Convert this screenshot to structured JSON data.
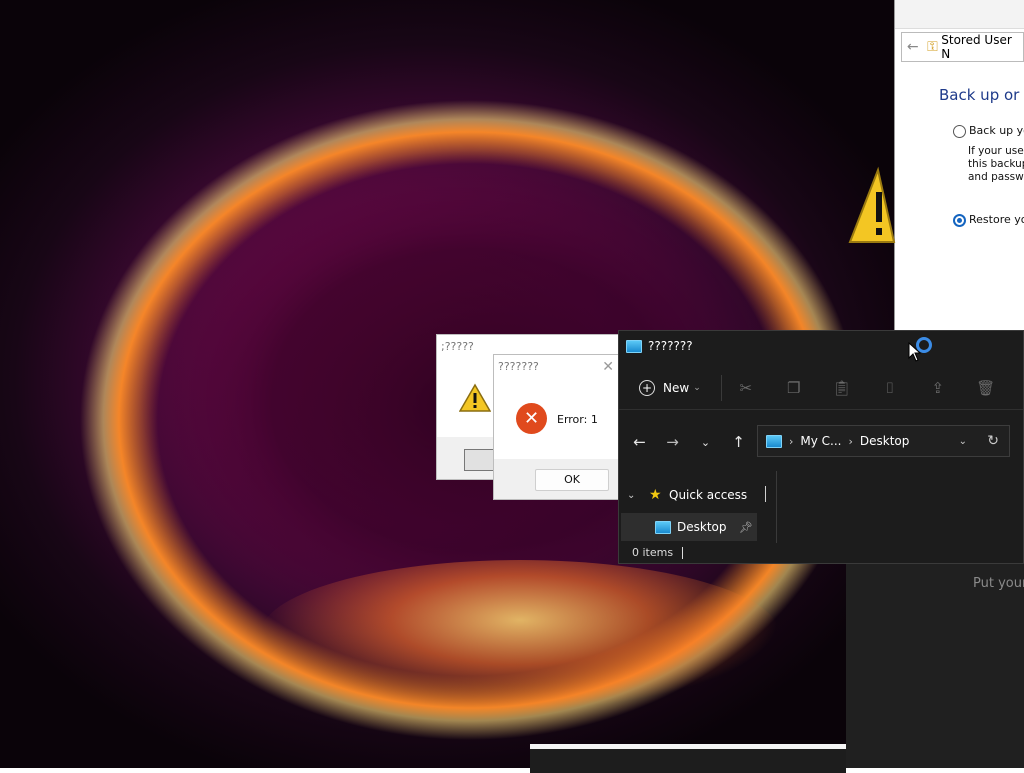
{
  "stored_window": {
    "title": "Stored User N",
    "heading": "Back up or re",
    "option_backup": "Back up you",
    "backup_desc_line1": "If your user n",
    "backup_desc_line2": "this backup",
    "backup_desc_line3": "and passwo",
    "option_restore": "Restore you"
  },
  "dialog_warning": {
    "title": ";?????"
  },
  "dialog_error": {
    "title": "???????",
    "message": "Error: 1",
    "ok_label": "OK"
  },
  "explorer": {
    "title": "???????",
    "new_label": "New",
    "breadcrumb_root": "My C...",
    "breadcrumb_current": "Desktop",
    "quick_access_label": "Quick access",
    "sidebar_desktop_label": "Desktop",
    "status_items": "0 items"
  },
  "dark_panel": {
    "text": "Put your"
  },
  "colors": {
    "explorer_bg": "#1c1c1c",
    "error_icon": "#e04a1d",
    "accent_blue": "#1565c0",
    "quick_access_star": "#f2c811"
  }
}
